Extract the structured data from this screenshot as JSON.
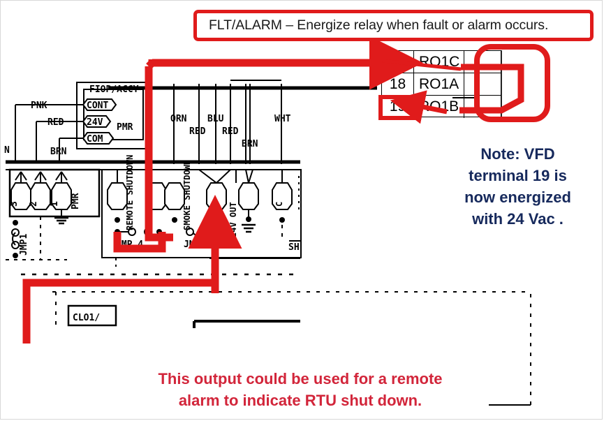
{
  "callout": {
    "text": "FLT/ALARM – Energize relay when fault or alarm occurs."
  },
  "note": {
    "line1": "Note: VFD",
    "line2": "terminal 19 is",
    "line3": "now energized",
    "line4": "with 24 Vac ."
  },
  "caption": {
    "line1": "This output could be used for a remote",
    "line2": "alarm to indicate RTU shut down."
  },
  "terminal_table": {
    "rows": [
      {
        "number": "17",
        "name": "RO1C"
      },
      {
        "number": "18",
        "name": "RO1A"
      },
      {
        "number": "19",
        "name": "RO1B"
      }
    ],
    "highlighted_terminal": "19"
  },
  "schematic": {
    "module_title": "FIOP/ACCY",
    "module_side_label": "PMR",
    "module_terminals": [
      "CONT",
      "24V",
      "COM"
    ],
    "left_wire_labels": [
      "PNK",
      "RED",
      "BRN"
    ],
    "neutral_label": "N",
    "bus_terminals": [
      "3",
      "2",
      "1"
    ],
    "bus_label": "PMR",
    "jumpers": [
      "JMP1",
      "JMP 4",
      "JMP 3"
    ],
    "wire_labels": [
      "ORN",
      "RED",
      "BLU",
      "RED",
      "BRN",
      "WHT"
    ],
    "terminal_labels": [
      "REMOTE SHUTDOWN",
      "SMOKE SHUTDOWN",
      "24V OUT",
      "C",
      "SH"
    ],
    "bottom_box_label": "CLO1/"
  },
  "colors": {
    "annotation_red": "#e01b1b",
    "caption_red": "#d2253a",
    "note_navy": "#16295c",
    "wire_black": "#000000"
  }
}
